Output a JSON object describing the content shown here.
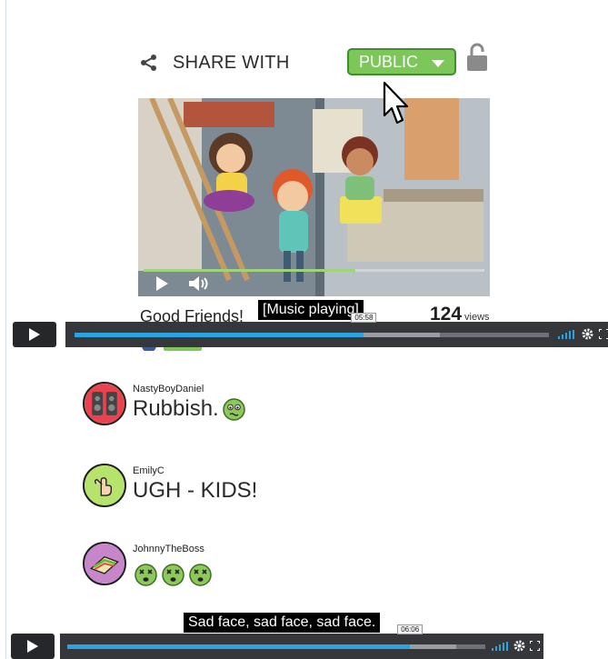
{
  "share": {
    "label": "SHARE WITH",
    "visibility": "PUBLIC",
    "visibility_color": "#7cc65a"
  },
  "video": {
    "title": "Good Friends!",
    "views_count": "124",
    "views_label": "views",
    "caption": "[Music playing]",
    "thumb_progress": 0.62
  },
  "player_top": {
    "time": "05:58",
    "played": 0.61,
    "loaded": 0.77
  },
  "comments": [
    {
      "user": "NastyBoyDaniel",
      "text": "Rubbish.",
      "avatar_color": "#e8434f",
      "emoji": [
        "sick-face"
      ]
    },
    {
      "user": "EmilyC",
      "text": "UGH - KIDS!",
      "avatar_color": "#b6e36b",
      "emoji": []
    },
    {
      "user": "JohnnyTheBoss",
      "text": "",
      "avatar_color": "#c786c9",
      "emoji": [
        "dizzy-face",
        "dizzy-face",
        "dizzy-face"
      ]
    }
  ],
  "player_bottom": {
    "caption": "Sad face, sad face, sad face.",
    "time": "06:06",
    "played": 0.82,
    "loaded": 0.93
  },
  "colors": {
    "accent_blue": "#2aa4e0",
    "player_dark": "#26272a",
    "emoji_green": "#8dc95a"
  }
}
